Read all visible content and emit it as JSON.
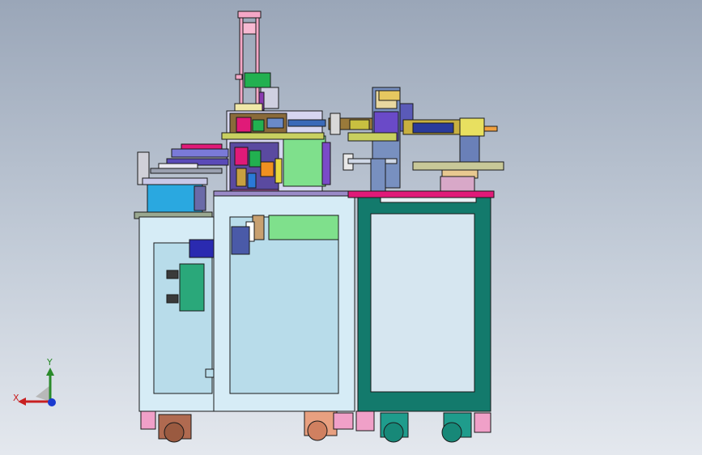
{
  "viewport": {
    "background_top": "#9aa6b8",
    "background_bottom": "#e4e8ee"
  },
  "model": {
    "left_frame_color": "#d6ecf6",
    "right_frame_color": "#137a6c",
    "left_caster_color": "#b06a50",
    "right_caster_color": "#1f9c8c",
    "tabletop_accent": "#e01a78"
  },
  "triad": {
    "x_label": "X",
    "y_label": "Y",
    "x_axis_color": "#c82020",
    "y_axis_color": "#2a8a2a",
    "z_axis_color": "#1a3ad0"
  }
}
